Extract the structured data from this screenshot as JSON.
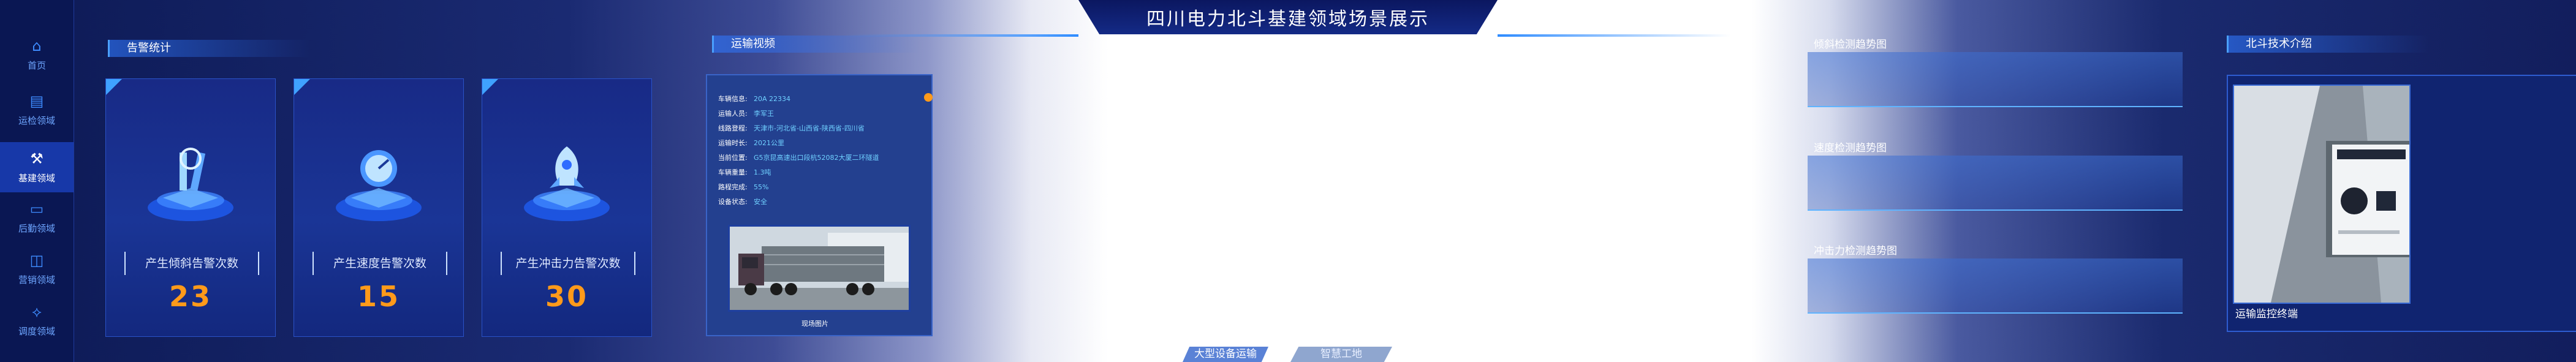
{
  "title": "四川电力北斗基建领域场景展示",
  "sidebar": {
    "items": [
      {
        "label": "首页",
        "icon": "home-icon",
        "active": false
      },
      {
        "label": "运检领域",
        "icon": "clipboard-icon",
        "active": false
      },
      {
        "label": "基建领域",
        "icon": "crane-icon",
        "active": true
      },
      {
        "label": "后勤领域",
        "icon": "book-icon",
        "active": false
      },
      {
        "label": "营销领域",
        "icon": "chart-icon",
        "active": false
      },
      {
        "label": "调度领域",
        "icon": "network-icon",
        "active": false
      }
    ]
  },
  "alarm": {
    "section_title": "告警统计",
    "cards": [
      {
        "label": "产生倾斜告警次数",
        "value": "23",
        "icon": "tilt-icon"
      },
      {
        "label": "产生速度告警次数",
        "value": "15",
        "icon": "speedometer-icon"
      },
      {
        "label": "产生冲击力告警次数",
        "value": "30",
        "icon": "rocket-icon"
      }
    ]
  },
  "transport": {
    "section_title": "运输视频",
    "fields": [
      {
        "key": "车辆信息:",
        "value": "20A 22334"
      },
      {
        "key": "运输人员:",
        "value": "李军王"
      },
      {
        "key": "线路登程:",
        "value": "天津市-河北省-山西省-陕西省-四川省"
      },
      {
        "key": "运输时长:",
        "value": "2021公里"
      },
      {
        "key": "当前位置:",
        "value": "G5京昆高速出口段杭52082大厦二环隧道"
      },
      {
        "key": "车辆重量:",
        "value": "1.3吨"
      },
      {
        "key": "路程完成:",
        "value": "55%"
      },
      {
        "key": "设备状态:",
        "value": "安全"
      }
    ],
    "image_caption": "现场图片",
    "progress_percent": 55
  },
  "charts": [
    {
      "title": "倾斜检测趋势图"
    },
    {
      "title": "速度检测趋势图"
    },
    {
      "title": "冲击力检测趋势图"
    }
  ],
  "beidou": {
    "section_title": "北斗技术介绍",
    "photo_caption": "运输监控终端"
  },
  "bottom_tabs": [
    {
      "label": "大型设备运输",
      "active": true
    },
    {
      "label": "智慧工地",
      "active": false
    }
  ],
  "colors": {
    "accent": "#2f8cff",
    "number": "#ff9a1a",
    "value_text": "#6fd0ff"
  }
}
